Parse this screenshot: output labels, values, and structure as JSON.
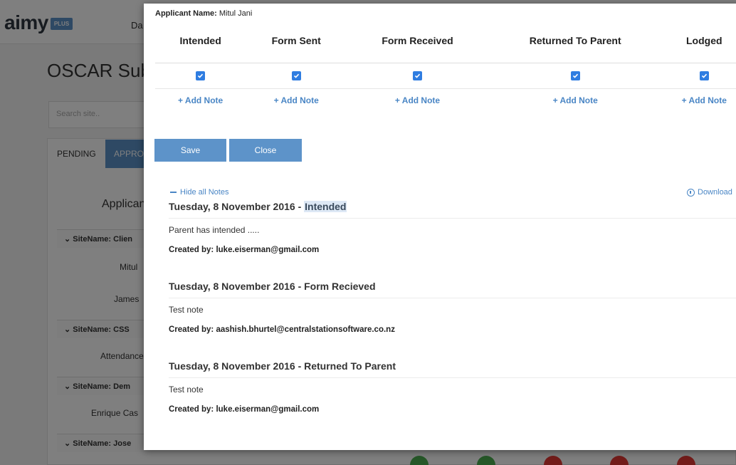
{
  "background": {
    "logo_text": "aimy",
    "logo_badge": "PLUS",
    "nav_partial": "Da",
    "page_title_partial": "OSCAR Sub",
    "search_placeholder": "Search site..",
    "tabs": [
      "PENDING",
      "APPRO"
    ],
    "applicant_header_partial": "Applican",
    "rows": [
      {
        "label": "SiteName: Clien"
      },
      {
        "label": "SiteName: CSS"
      },
      {
        "label": "SiteName: Dem"
      },
      {
        "label": "SiteName: Jose"
      }
    ],
    "sub_items": [
      "Mitul",
      "James",
      "Attendance",
      "Enrique Cas"
    ]
  },
  "modal": {
    "applicant_label": "Applicant Name:",
    "applicant_name": "Mitul Jani",
    "columns": [
      {
        "header": "Intended",
        "checked": true,
        "add_note": "+ Add Note"
      },
      {
        "header": "Form Sent",
        "checked": true,
        "add_note": "+ Add Note"
      },
      {
        "header": "Form Received",
        "checked": true,
        "add_note": "+ Add Note"
      },
      {
        "header": "Returned To Parent",
        "checked": true,
        "add_note": "+ Add Note"
      },
      {
        "header": "Lodged",
        "checked": true,
        "add_note": "+ Add Note"
      }
    ],
    "save_label": "Save",
    "close_label": "Close",
    "hide_notes_label": "Hide all Notes",
    "download_label": "Download",
    "notes": [
      {
        "date": "Tuesday, 8 November 2016 - ",
        "status": "Intended",
        "text": "Parent has intended .....",
        "created_by": "Created by: luke.eiserman@gmail.com"
      },
      {
        "date": "Tuesday, 8 November 2016 - ",
        "status": "Form Recieved",
        "text": "Test note",
        "created_by": "Created by: aashish.bhurtel@centralstationsoftware.co.nz"
      },
      {
        "date": "Tuesday, 8 November 2016 - ",
        "status": "Returned To Parent",
        "text": "Test note",
        "created_by": "Created by: luke.eiserman@gmail.com"
      }
    ]
  },
  "colors": {
    "accent": "#5d93c9",
    "link": "#4a86c5",
    "checkbox": "#2f7de1",
    "overlay": "rgba(0,0,0,0.5)"
  }
}
